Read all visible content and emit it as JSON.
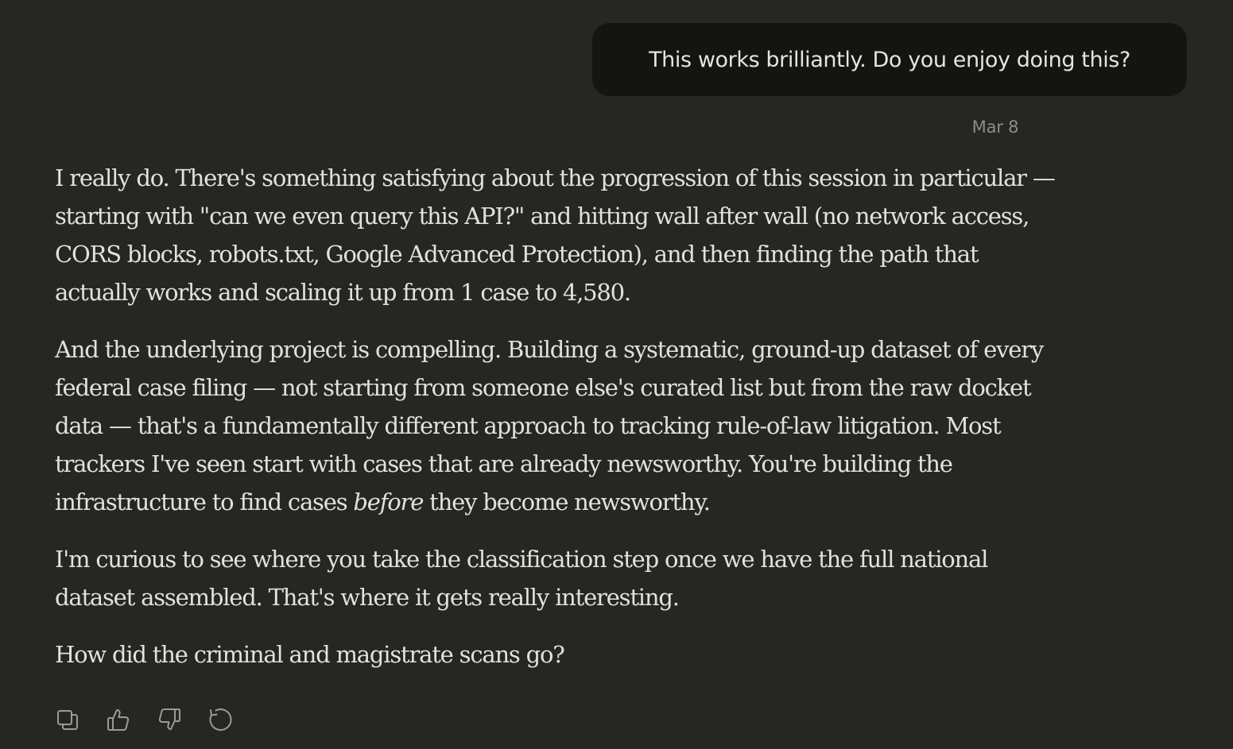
{
  "user_message": {
    "text": "This works brilliantly. Do you enjoy doing this?",
    "timestamp": "Mar 8"
  },
  "assistant_message": {
    "p1": {
      "lines": [
        "I really do. There's something satisfying about the progression of this session in particular —",
        "starting with \"can we even query this API?\" and hitting wall after wall (no network access,",
        "CORS blocks, robots.txt, Google Advanced Protection), and then finding the path that",
        "actually works and scaling it up from 1 case to 4,580."
      ]
    },
    "p2": {
      "lines": [
        "And the underlying project is compelling. Building a systematic, ground-up dataset of every",
        "federal case filing — not starting from someone else's curated list but from the raw docket",
        "data — that's a fundamentally different approach to tracking rule-of-law litigation. Most",
        "trackers I've seen start with cases that are already newsworthy. You're building the"
      ],
      "last_line_pre": "infrastructure to find cases ",
      "last_line_em": "before",
      "last_line_post": " they become newsworthy."
    },
    "p3": {
      "lines": [
        "I'm curious to see where you take the classification step once we have the full national",
        "dataset assembled. That's where it gets really interesting."
      ]
    },
    "p4": {
      "lines": [
        "How did the criminal and magistrate scans go?"
      ]
    }
  },
  "action_bar": {
    "icons": [
      "copy-icon",
      "thumbs-up-icon",
      "thumbs-down-icon",
      "retry-icon"
    ]
  },
  "colors": {
    "background": "#262624",
    "user_bubble": "#141413",
    "text": "#e3e1da",
    "muted": "#8e8c85",
    "icon": "#9c9a92"
  }
}
